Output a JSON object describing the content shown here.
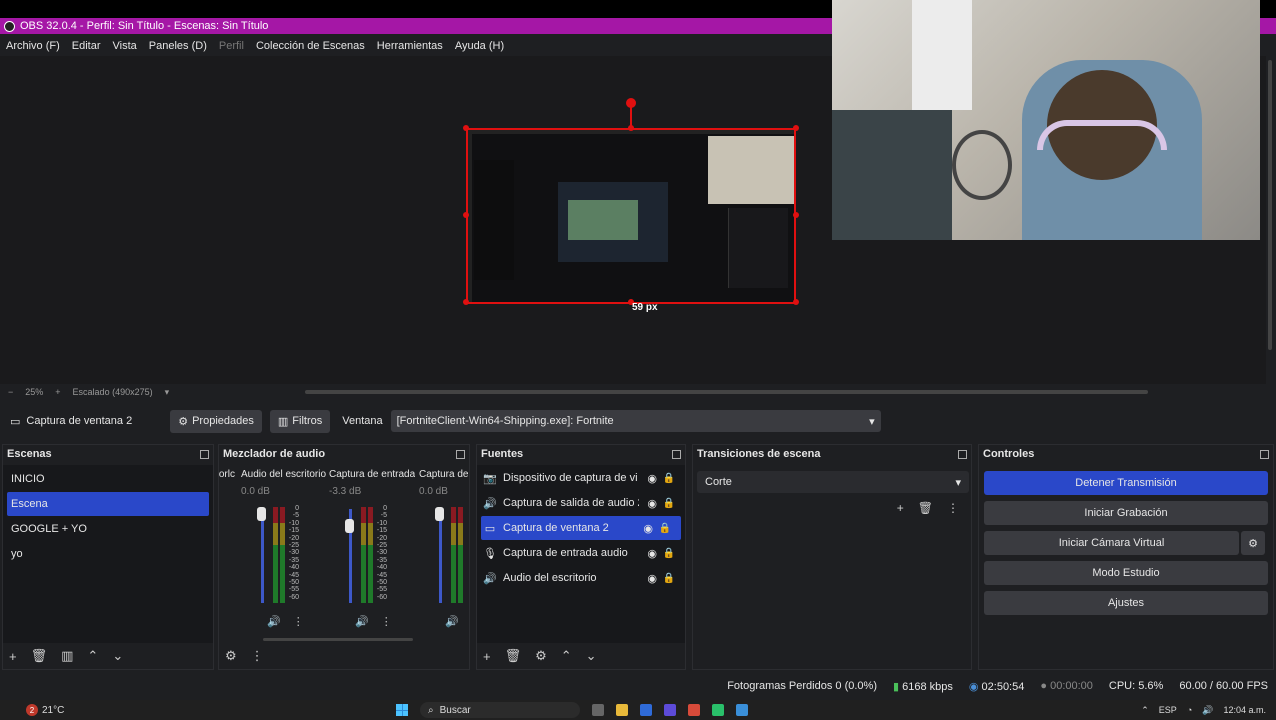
{
  "window": {
    "title": "OBS 32.0.4 - Perfil: Sin Título - Escenas: Sin Título"
  },
  "menu": {
    "items": [
      {
        "label": "Archivo (F)",
        "dim": false
      },
      {
        "label": "Editar",
        "dim": false
      },
      {
        "label": "Vista",
        "dim": false
      },
      {
        "label": "Paneles (D)",
        "dim": false
      },
      {
        "label": "Perfil",
        "dim": true
      },
      {
        "label": "Colección de Escenas",
        "dim": false
      },
      {
        "label": "Herramientas",
        "dim": false
      },
      {
        "label": "Ayuda (H)",
        "dim": false
      }
    ]
  },
  "preview": {
    "distance_label": "59 px",
    "zoom": "25%",
    "scale_label": "Escalado (490x275)"
  },
  "source_bar": {
    "selected_source": "Captura de ventana 2",
    "properties_label": "Propiedades",
    "filters_label": "Filtros",
    "window_label": "Ventana",
    "window_value": "[FortniteClient-Win64-Shipping.exe]: Fortnite"
  },
  "scenes": {
    "title": "Escenas",
    "items": [
      {
        "label": "INICIO"
      },
      {
        "label": "Escena"
      },
      {
        "label": "GOOGLE + YO"
      },
      {
        "label": "yo"
      }
    ],
    "selected_index": 1
  },
  "mixer": {
    "title": "Mezclador de audio",
    "channels": [
      {
        "name": "orlc",
        "db": ""
      },
      {
        "name": "Audio del escritorio",
        "db": "0.0 dB"
      },
      {
        "name": "Captura de entrada",
        "db": "-3.3 dB"
      },
      {
        "name": "Captura de",
        "db": "0.0 dB"
      }
    ],
    "scale": [
      "0",
      "-5",
      "-10",
      "-15",
      "-20",
      "-25",
      "-30",
      "-35",
      "-40",
      "-45",
      "-50",
      "-55",
      "-60"
    ]
  },
  "sources": {
    "title": "Fuentes",
    "items": [
      {
        "icon": "camera-icon",
        "glyph": "📷",
        "label": "Dispositivo de captura de vi"
      },
      {
        "icon": "speaker-icon",
        "glyph": "🔊",
        "label": "Captura de salida de audio 2"
      },
      {
        "icon": "window-icon",
        "glyph": "▭",
        "label": "Captura de ventana 2"
      },
      {
        "icon": "microphone-icon",
        "glyph": "🎙",
        "label": "Captura de entrada audio"
      },
      {
        "icon": "speaker-icon",
        "glyph": "🔊",
        "label": "Audio del escritorio"
      }
    ],
    "selected_index": 2
  },
  "transitions": {
    "title": "Transiciones de escena",
    "selected": "Corte"
  },
  "controls": {
    "title": "Controles",
    "buttons": [
      {
        "label": "Detener Transmisión",
        "active": true
      },
      {
        "label": "Iniciar Grabación",
        "active": false
      },
      {
        "label": "Iniciar Cámara Virtual",
        "active": false
      },
      {
        "label": "Modo Estudio",
        "active": false
      },
      {
        "label": "Ajustes",
        "active": false
      }
    ]
  },
  "status": {
    "dropped_frames": "Fotogramas Perdidos 0 (0.0%)",
    "bitrate": "6168 kbps",
    "stream_time": "02:50:54",
    "rec_time": "00:00:00",
    "cpu": "CPU: 5.6%",
    "fps": "60.00 / 60.00 FPS"
  },
  "taskbar": {
    "weather": "21°C",
    "weather_badge": "2",
    "search": "Buscar",
    "lang": "ESP",
    "time": "12:04 a.m."
  }
}
